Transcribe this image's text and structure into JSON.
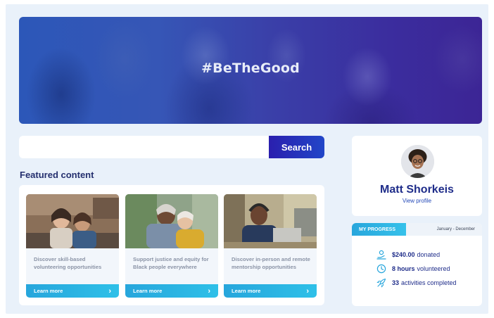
{
  "hero": {
    "hashtag": "#BeTheGood"
  },
  "search": {
    "placeholder": "",
    "button_label": "Search"
  },
  "featured": {
    "heading": "Featured content",
    "cards": [
      {
        "text": "Discover skill-based volunteering opportunities",
        "cta": "Learn more",
        "image": "volunteers-smiling-photo"
      },
      {
        "text": "Support justice and equity for Black people everywhere",
        "cta": "Learn more",
        "image": "people-hugging-photo"
      },
      {
        "text": "Discover in-person and remote mentorship opportunities",
        "cta": "Learn more",
        "image": "man-with-headphones-laptop-photo"
      }
    ]
  },
  "profile": {
    "name": "Matt Shorkeis",
    "link": "View profile"
  },
  "progress": {
    "badge": "MY PROGRESS",
    "range": "January - December",
    "stats": [
      {
        "icon": "donation-hand-icon",
        "value": "$240.00",
        "label": "donated"
      },
      {
        "icon": "clock-icon",
        "value": "8 hours",
        "label": "volunteered"
      },
      {
        "icon": "rocket-icon",
        "value": "33",
        "label": "activities completed"
      }
    ]
  },
  "colors": {
    "navy": "#1f2d8a",
    "accent_cyan": "#2ec0e8",
    "search_button": "#2a1fae",
    "background": "#e9f1fa"
  }
}
